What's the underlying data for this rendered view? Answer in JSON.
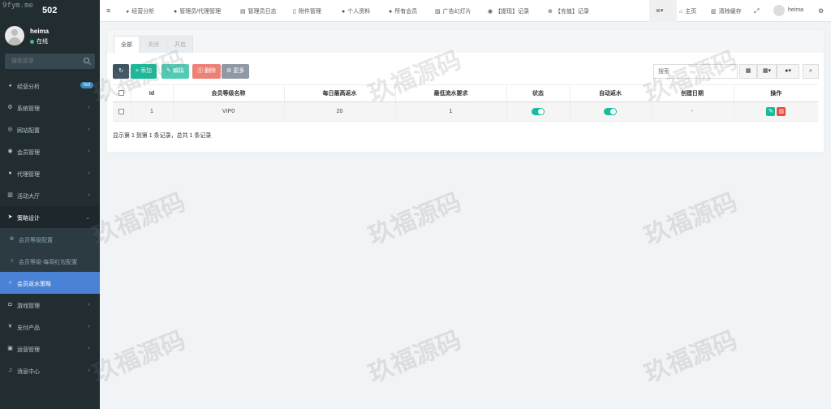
{
  "brand": {
    "watermark_text": "9fym.me",
    "title": "502"
  },
  "user": {
    "name": "heima",
    "status": "在线"
  },
  "search": {
    "placeholder": "搜索菜单"
  },
  "sidebar": {
    "items": [
      {
        "label": "经营分析",
        "icon": "dashboard-icon",
        "badge": "hot"
      },
      {
        "label": "系统管理",
        "icon": "cogs-icon"
      },
      {
        "label": "网站配置",
        "icon": "globe-icon"
      },
      {
        "label": "会员管理",
        "icon": "user-circle-icon"
      },
      {
        "label": "代理管理",
        "icon": "user-icon"
      },
      {
        "label": "活动大厅",
        "icon": "building-icon"
      },
      {
        "label": "策略设计",
        "icon": "paper-plane-icon"
      },
      {
        "label": "会员等级配置",
        "icon": "trophy-icon"
      },
      {
        "label": "会员等级-每周红包配置",
        "icon": "circle-icon"
      },
      {
        "label": "会员返水策略",
        "icon": "circle-icon"
      },
      {
        "label": "游戏管理",
        "icon": "gamepad-icon"
      },
      {
        "label": "支付产品",
        "icon": "yen-icon"
      },
      {
        "label": "运营管理",
        "icon": "briefcase-icon"
      },
      {
        "label": "消息中心",
        "icon": "bell-icon"
      }
    ]
  },
  "topnav": {
    "items": [
      {
        "label": "经营分析",
        "icon": "dashboard-icon"
      },
      {
        "label": "管理员/代理管理",
        "icon": "user-icon"
      },
      {
        "label": "管理员日志",
        "icon": "list-icon"
      },
      {
        "label": "附件管理",
        "icon": "file-icon"
      },
      {
        "label": "个人资料",
        "icon": "user-icon"
      },
      {
        "label": "所有会员",
        "icon": "users-icon"
      },
      {
        "label": "广告幻灯片",
        "icon": "image-icon"
      },
      {
        "label": "【提现】记录",
        "icon": "circle-icon"
      },
      {
        "label": "【充值】记录",
        "icon": "plus-circle-icon"
      }
    ],
    "home": "主页",
    "clear_cache": "清除缓存",
    "username": "heima"
  },
  "tabs": [
    "全部",
    "关闭",
    "开启"
  ],
  "toolbar": {
    "add": "添加",
    "edit": "编辑",
    "delete": "删除",
    "more": "更多",
    "search_placeholder": "搜索"
  },
  "table": {
    "headers": [
      "Id",
      "会员等级名称",
      "每日最高返水",
      "最低流水要求",
      "状态",
      "自动返水",
      "创建日期",
      "操作"
    ],
    "rows": [
      {
        "id": "1",
        "name": "VIP0",
        "daily_max": "20",
        "min_flow": "1",
        "status_on": true,
        "auto_on": true,
        "created": "-"
      }
    ]
  },
  "summary": "显示第 1 到第 1 条记录，总共 1 条记录",
  "watermarks": [
    "玖福源码"
  ]
}
